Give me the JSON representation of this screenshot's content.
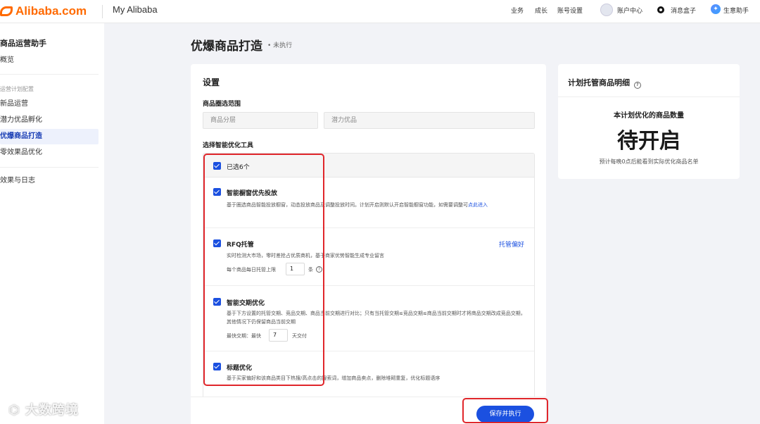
{
  "topbar": {
    "logo": "Alibaba.com",
    "my_title": "My Alibaba",
    "nav": [
      "业务",
      "成长",
      "账号设置"
    ],
    "account": "账户中心",
    "message": "消息盒子",
    "assistant": "生意助手"
  },
  "sidebar": {
    "title": "商品运营助手",
    "overview": "概览",
    "group_label": "运营计划配置",
    "items": [
      "新品运营",
      "潜力优品孵化",
      "优爆商品打造",
      "零效果品优化"
    ],
    "active_index": 2,
    "logs": "效果与日志"
  },
  "page": {
    "title": "优爆商品打造",
    "status": "• 未执行"
  },
  "settings": {
    "heading": "设置",
    "range_label": "商品圈选范围",
    "select1_placeholder": "商品分层",
    "select2_placeholder": "潜力优品",
    "tools_label": "选择智能优化工具",
    "selected_count": "已选6个",
    "tools": [
      {
        "name": "智能橱窗优先投放",
        "desc": "基于圈选商品智能投放橱窗，动态投放商品及调整投放时间。计划开启则默认开启智能橱窗功能，如需要调整可",
        "link": "点此进入"
      },
      {
        "name": "RFQ托管",
        "desc": "实时检测大市场，零时差抢占优质商机，基于商家优势智能生成专业留言",
        "pref_link": "托管偏好",
        "limit_label": "每个商品每日托管上限",
        "limit_value": "1",
        "limit_unit": "条"
      },
      {
        "name": "智能交期优化",
        "desc": "基于下方设置的托管交期、竞品交期、商品当前交期进行对比；只有当托管交期≤竞品交期≤商品当前交期时才将商品交期改成竞品交期，其他情况下仍保留商品当前交期",
        "fastest_label": "最快交期：最快",
        "fastest_value": "7",
        "fastest_unit": "天交付"
      },
      {
        "name": "标题优化",
        "desc": "基于买家偏好和该商品类目下热搜/高点击的搜索词，增加商品卖点，删除堆砌重复，优化标题语序"
      }
    ],
    "save_button": "保存并执行"
  },
  "plan": {
    "heading": "计划托管商品明细",
    "sub": "本计划优化的商品数量",
    "big": "待开启",
    "note": "预计每晚0点后能看到实际优化商品名单"
  },
  "watermark": "大数跨境",
  "colors": {
    "primary": "#1b50e0",
    "brand": "#ff6a00",
    "highlight": "#e0262b"
  }
}
